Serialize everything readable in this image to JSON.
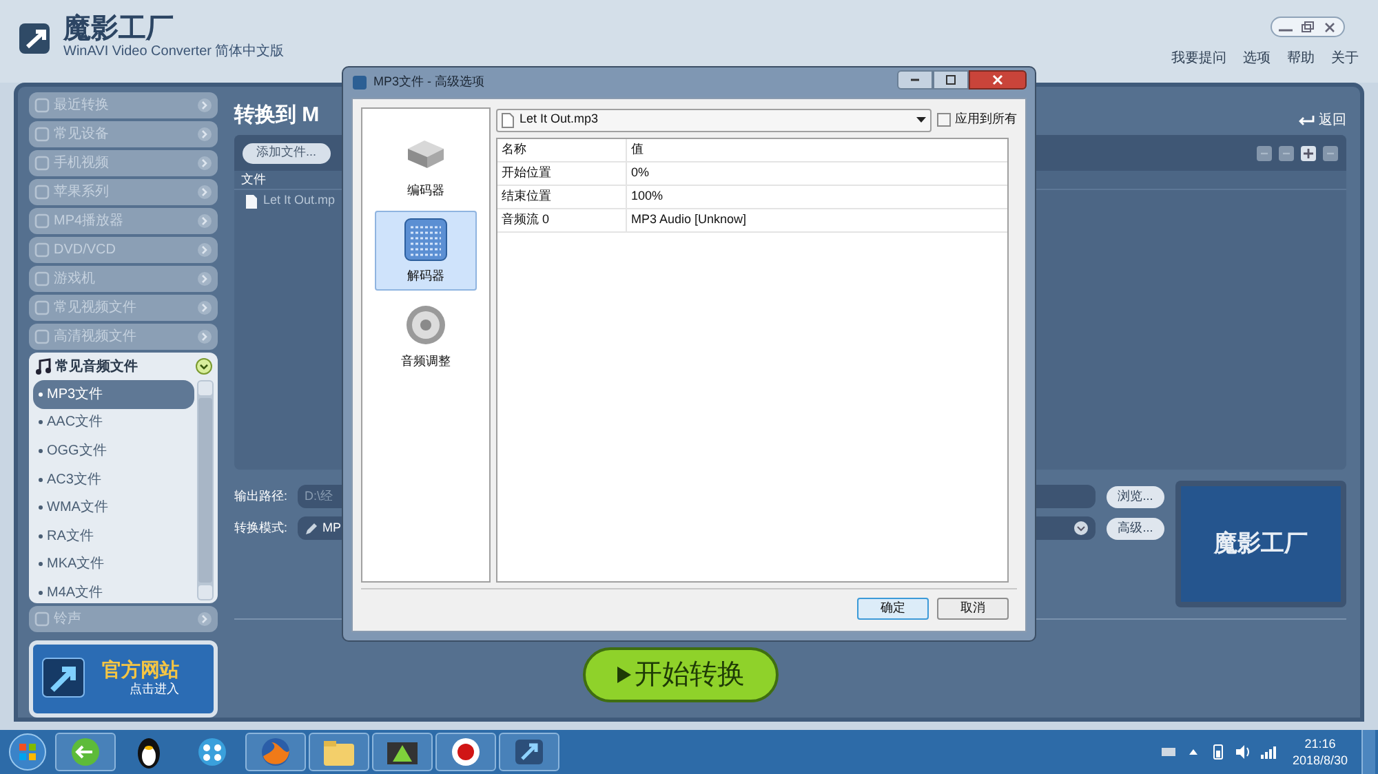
{
  "app": {
    "title": "魔影工厂",
    "subtitle": "WinAVI Video Converter 简体中文版",
    "menu": [
      "我要提问",
      "选项",
      "帮助",
      "关于"
    ]
  },
  "sidebar": {
    "categories": [
      {
        "label": "最近转换",
        "expanded": false
      },
      {
        "label": "常见设备",
        "expanded": false
      },
      {
        "label": "手机视频",
        "expanded": false
      },
      {
        "label": "苹果系列",
        "expanded": false
      },
      {
        "label": "MP4播放器",
        "expanded": false
      },
      {
        "label": "DVD/VCD",
        "expanded": false
      },
      {
        "label": "游戏机",
        "expanded": false
      },
      {
        "label": "常见视频文件",
        "expanded": false
      },
      {
        "label": "高清视频文件",
        "expanded": false
      },
      {
        "label": "常见音频文件",
        "expanded": true,
        "items": [
          {
            "label": "MP3文件",
            "selected": true
          },
          {
            "label": "AAC文件",
            "selected": false
          },
          {
            "label": "OGG文件",
            "selected": false
          },
          {
            "label": "AC3文件",
            "selected": false
          },
          {
            "label": "WMA文件",
            "selected": false
          },
          {
            "label": "RA文件",
            "selected": false
          },
          {
            "label": "MKA文件",
            "selected": false
          },
          {
            "label": "M4A文件",
            "selected": false
          }
        ]
      },
      {
        "label": "铃声",
        "expanded": false
      }
    ],
    "banner": {
      "title": "官方网站",
      "subtitle": "点击进入"
    }
  },
  "content": {
    "heading": "转换到 M",
    "back": "返回",
    "add_button": "添加文件...",
    "file_column": "文件",
    "files": [
      "Let It Out.mp"
    ],
    "output_label": "输出路径:",
    "output_value": "D:\\经",
    "browse_button": "浏览...",
    "mode_label": "转换模式:",
    "mode_value": "MP",
    "advanced_button": "高级...",
    "preview_text": "魔影工厂",
    "start_button": "开始转换"
  },
  "dialog": {
    "title": "MP3文件 - 高级选项",
    "nav": [
      {
        "label": "编码器",
        "selected": false,
        "kind": "encoder"
      },
      {
        "label": "解码器",
        "selected": true,
        "kind": "decoder"
      },
      {
        "label": "音频调整",
        "selected": false,
        "kind": "audio"
      }
    ],
    "file": "Let It Out.mp3",
    "apply_all": {
      "label": "应用到所有",
      "checked": false
    },
    "columns": [
      "名称",
      "值"
    ],
    "rows": [
      [
        "开始位置",
        "0%"
      ],
      [
        "结束位置",
        "100%"
      ],
      [
        "音频流 0",
        "MP3 Audio [Unknow]"
      ]
    ],
    "buttons": [
      "确定",
      "取消"
    ]
  },
  "taskbar": {
    "time": "21:16",
    "date": "2018/8/30"
  }
}
